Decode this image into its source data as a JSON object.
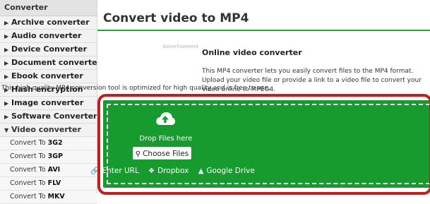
{
  "sidebar": {
    "header": "Converter",
    "items": [
      {
        "label": "Archive converter"
      },
      {
        "label": "Audio converter"
      },
      {
        "label": "Device Converter"
      },
      {
        "label": "Document converter"
      },
      {
        "label": "Ebook converter"
      },
      {
        "label": "Hash encryption"
      },
      {
        "label": "Image converter"
      },
      {
        "label": "Software Converter"
      },
      {
        "label": "Video converter"
      }
    ],
    "subitems": [
      {
        "prefix": "Convert To ",
        "format": "3G2"
      },
      {
        "prefix": "Convert To ",
        "format": "3GP"
      },
      {
        "prefix": "Convert To ",
        "format": "AVI"
      },
      {
        "prefix": "Convert To ",
        "format": "FLV"
      },
      {
        "prefix": "Convert To ",
        "format": "MKV"
      }
    ]
  },
  "main": {
    "title": "Convert video to MP4",
    "ad_label": "Advertisement",
    "section_title": "Online video converter",
    "description_1": "This MP4 converter lets you easily convert files to the MP4 format. Upload your video file or provide a link to a video file to convert your video online to MPEG4.",
    "description_2": "This high quality MP4 conversion tool is optimized for high quality and is free to use."
  },
  "upload": {
    "drop_text": "Drop Files here",
    "choose_label": "Choose Files",
    "sources": [
      {
        "label": "Enter URL",
        "icon": "link-icon"
      },
      {
        "label": "Dropbox",
        "icon": "dropbox-icon"
      },
      {
        "label": "Google Drive",
        "icon": "google-drive-icon"
      }
    ]
  },
  "colors": {
    "accent_green": "#179a2e",
    "highlight_red": "#c41d1d",
    "title_rule": "#2e9e3e"
  }
}
